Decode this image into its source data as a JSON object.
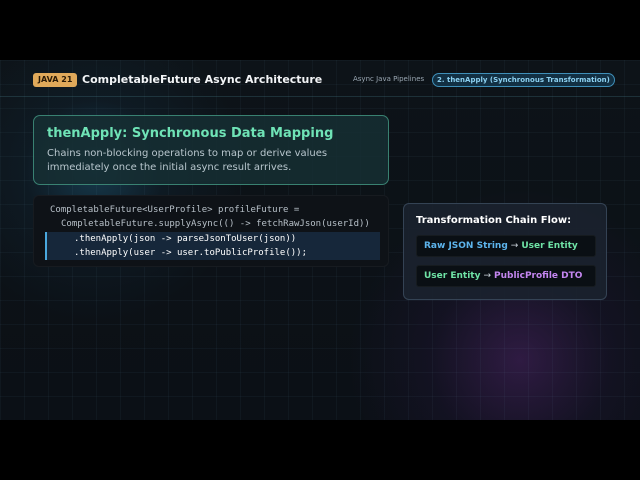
{
  "header": {
    "badge": "JAVA 21",
    "title": "CompletableFuture Async Architecture",
    "breadcrumb": "Async Java Pipelines",
    "active_step": "2. thenApply (Synchronous Transformation)"
  },
  "card": {
    "title": "thenApply: Synchronous Data Mapping",
    "description": "Chains non-blocking operations to map or derive values immediately once the initial async result arrives."
  },
  "code": {
    "lines": [
      "CompletableFuture<UserProfile> profileFuture =",
      "CompletableFuture.supplyAsync(() -> fetchRawJson(userId))",
      ".thenApply(json -> parseJsonToUser(json))",
      ".thenApply(user -> user.toPublicProfile());"
    ]
  },
  "flow": {
    "title": "Transformation Chain Flow:",
    "arrow": "→",
    "steps": [
      {
        "from": "Raw JSON String",
        "to": "User Entity"
      },
      {
        "from": "User Entity",
        "to": "PublicProfile DTO"
      }
    ]
  },
  "colors": {
    "accent_badge": "#e0a95a",
    "card_title": "#6fe3b6",
    "highlight_border": "#4aa8de",
    "raw_json": "#5db4ec",
    "user_entity": "#6fe3a6",
    "public_profile": "#c486f0"
  }
}
